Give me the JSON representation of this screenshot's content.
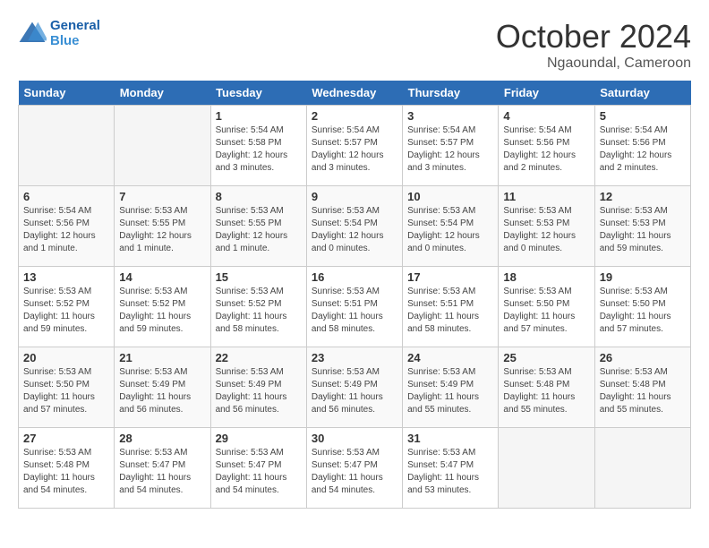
{
  "header": {
    "logo_line1": "General",
    "logo_line2": "Blue",
    "month": "October 2024",
    "location": "Ngaoundal, Cameroon"
  },
  "days_of_week": [
    "Sunday",
    "Monday",
    "Tuesday",
    "Wednesday",
    "Thursday",
    "Friday",
    "Saturday"
  ],
  "weeks": [
    [
      {
        "day": "",
        "text": ""
      },
      {
        "day": "",
        "text": ""
      },
      {
        "day": "1",
        "text": "Sunrise: 5:54 AM\nSunset: 5:58 PM\nDaylight: 12 hours\nand 3 minutes."
      },
      {
        "day": "2",
        "text": "Sunrise: 5:54 AM\nSunset: 5:57 PM\nDaylight: 12 hours\nand 3 minutes."
      },
      {
        "day": "3",
        "text": "Sunrise: 5:54 AM\nSunset: 5:57 PM\nDaylight: 12 hours\nand 3 minutes."
      },
      {
        "day": "4",
        "text": "Sunrise: 5:54 AM\nSunset: 5:56 PM\nDaylight: 12 hours\nand 2 minutes."
      },
      {
        "day": "5",
        "text": "Sunrise: 5:54 AM\nSunset: 5:56 PM\nDaylight: 12 hours\nand 2 minutes."
      }
    ],
    [
      {
        "day": "6",
        "text": "Sunrise: 5:54 AM\nSunset: 5:56 PM\nDaylight: 12 hours\nand 1 minute."
      },
      {
        "day": "7",
        "text": "Sunrise: 5:53 AM\nSunset: 5:55 PM\nDaylight: 12 hours\nand 1 minute."
      },
      {
        "day": "8",
        "text": "Sunrise: 5:53 AM\nSunset: 5:55 PM\nDaylight: 12 hours\nand 1 minute."
      },
      {
        "day": "9",
        "text": "Sunrise: 5:53 AM\nSunset: 5:54 PM\nDaylight: 12 hours\nand 0 minutes."
      },
      {
        "day": "10",
        "text": "Sunrise: 5:53 AM\nSunset: 5:54 PM\nDaylight: 12 hours\nand 0 minutes."
      },
      {
        "day": "11",
        "text": "Sunrise: 5:53 AM\nSunset: 5:53 PM\nDaylight: 12 hours\nand 0 minutes."
      },
      {
        "day": "12",
        "text": "Sunrise: 5:53 AM\nSunset: 5:53 PM\nDaylight: 11 hours\nand 59 minutes."
      }
    ],
    [
      {
        "day": "13",
        "text": "Sunrise: 5:53 AM\nSunset: 5:52 PM\nDaylight: 11 hours\nand 59 minutes."
      },
      {
        "day": "14",
        "text": "Sunrise: 5:53 AM\nSunset: 5:52 PM\nDaylight: 11 hours\nand 59 minutes."
      },
      {
        "day": "15",
        "text": "Sunrise: 5:53 AM\nSunset: 5:52 PM\nDaylight: 11 hours\nand 58 minutes."
      },
      {
        "day": "16",
        "text": "Sunrise: 5:53 AM\nSunset: 5:51 PM\nDaylight: 11 hours\nand 58 minutes."
      },
      {
        "day": "17",
        "text": "Sunrise: 5:53 AM\nSunset: 5:51 PM\nDaylight: 11 hours\nand 58 minutes."
      },
      {
        "day": "18",
        "text": "Sunrise: 5:53 AM\nSunset: 5:50 PM\nDaylight: 11 hours\nand 57 minutes."
      },
      {
        "day": "19",
        "text": "Sunrise: 5:53 AM\nSunset: 5:50 PM\nDaylight: 11 hours\nand 57 minutes."
      }
    ],
    [
      {
        "day": "20",
        "text": "Sunrise: 5:53 AM\nSunset: 5:50 PM\nDaylight: 11 hours\nand 57 minutes."
      },
      {
        "day": "21",
        "text": "Sunrise: 5:53 AM\nSunset: 5:49 PM\nDaylight: 11 hours\nand 56 minutes."
      },
      {
        "day": "22",
        "text": "Sunrise: 5:53 AM\nSunset: 5:49 PM\nDaylight: 11 hours\nand 56 minutes."
      },
      {
        "day": "23",
        "text": "Sunrise: 5:53 AM\nSunset: 5:49 PM\nDaylight: 11 hours\nand 56 minutes."
      },
      {
        "day": "24",
        "text": "Sunrise: 5:53 AM\nSunset: 5:49 PM\nDaylight: 11 hours\nand 55 minutes."
      },
      {
        "day": "25",
        "text": "Sunrise: 5:53 AM\nSunset: 5:48 PM\nDaylight: 11 hours\nand 55 minutes."
      },
      {
        "day": "26",
        "text": "Sunrise: 5:53 AM\nSunset: 5:48 PM\nDaylight: 11 hours\nand 55 minutes."
      }
    ],
    [
      {
        "day": "27",
        "text": "Sunrise: 5:53 AM\nSunset: 5:48 PM\nDaylight: 11 hours\nand 54 minutes."
      },
      {
        "day": "28",
        "text": "Sunrise: 5:53 AM\nSunset: 5:47 PM\nDaylight: 11 hours\nand 54 minutes."
      },
      {
        "day": "29",
        "text": "Sunrise: 5:53 AM\nSunset: 5:47 PM\nDaylight: 11 hours\nand 54 minutes."
      },
      {
        "day": "30",
        "text": "Sunrise: 5:53 AM\nSunset: 5:47 PM\nDaylight: 11 hours\nand 54 minutes."
      },
      {
        "day": "31",
        "text": "Sunrise: 5:53 AM\nSunset: 5:47 PM\nDaylight: 11 hours\nand 53 minutes."
      },
      {
        "day": "",
        "text": ""
      },
      {
        "day": "",
        "text": ""
      }
    ]
  ]
}
